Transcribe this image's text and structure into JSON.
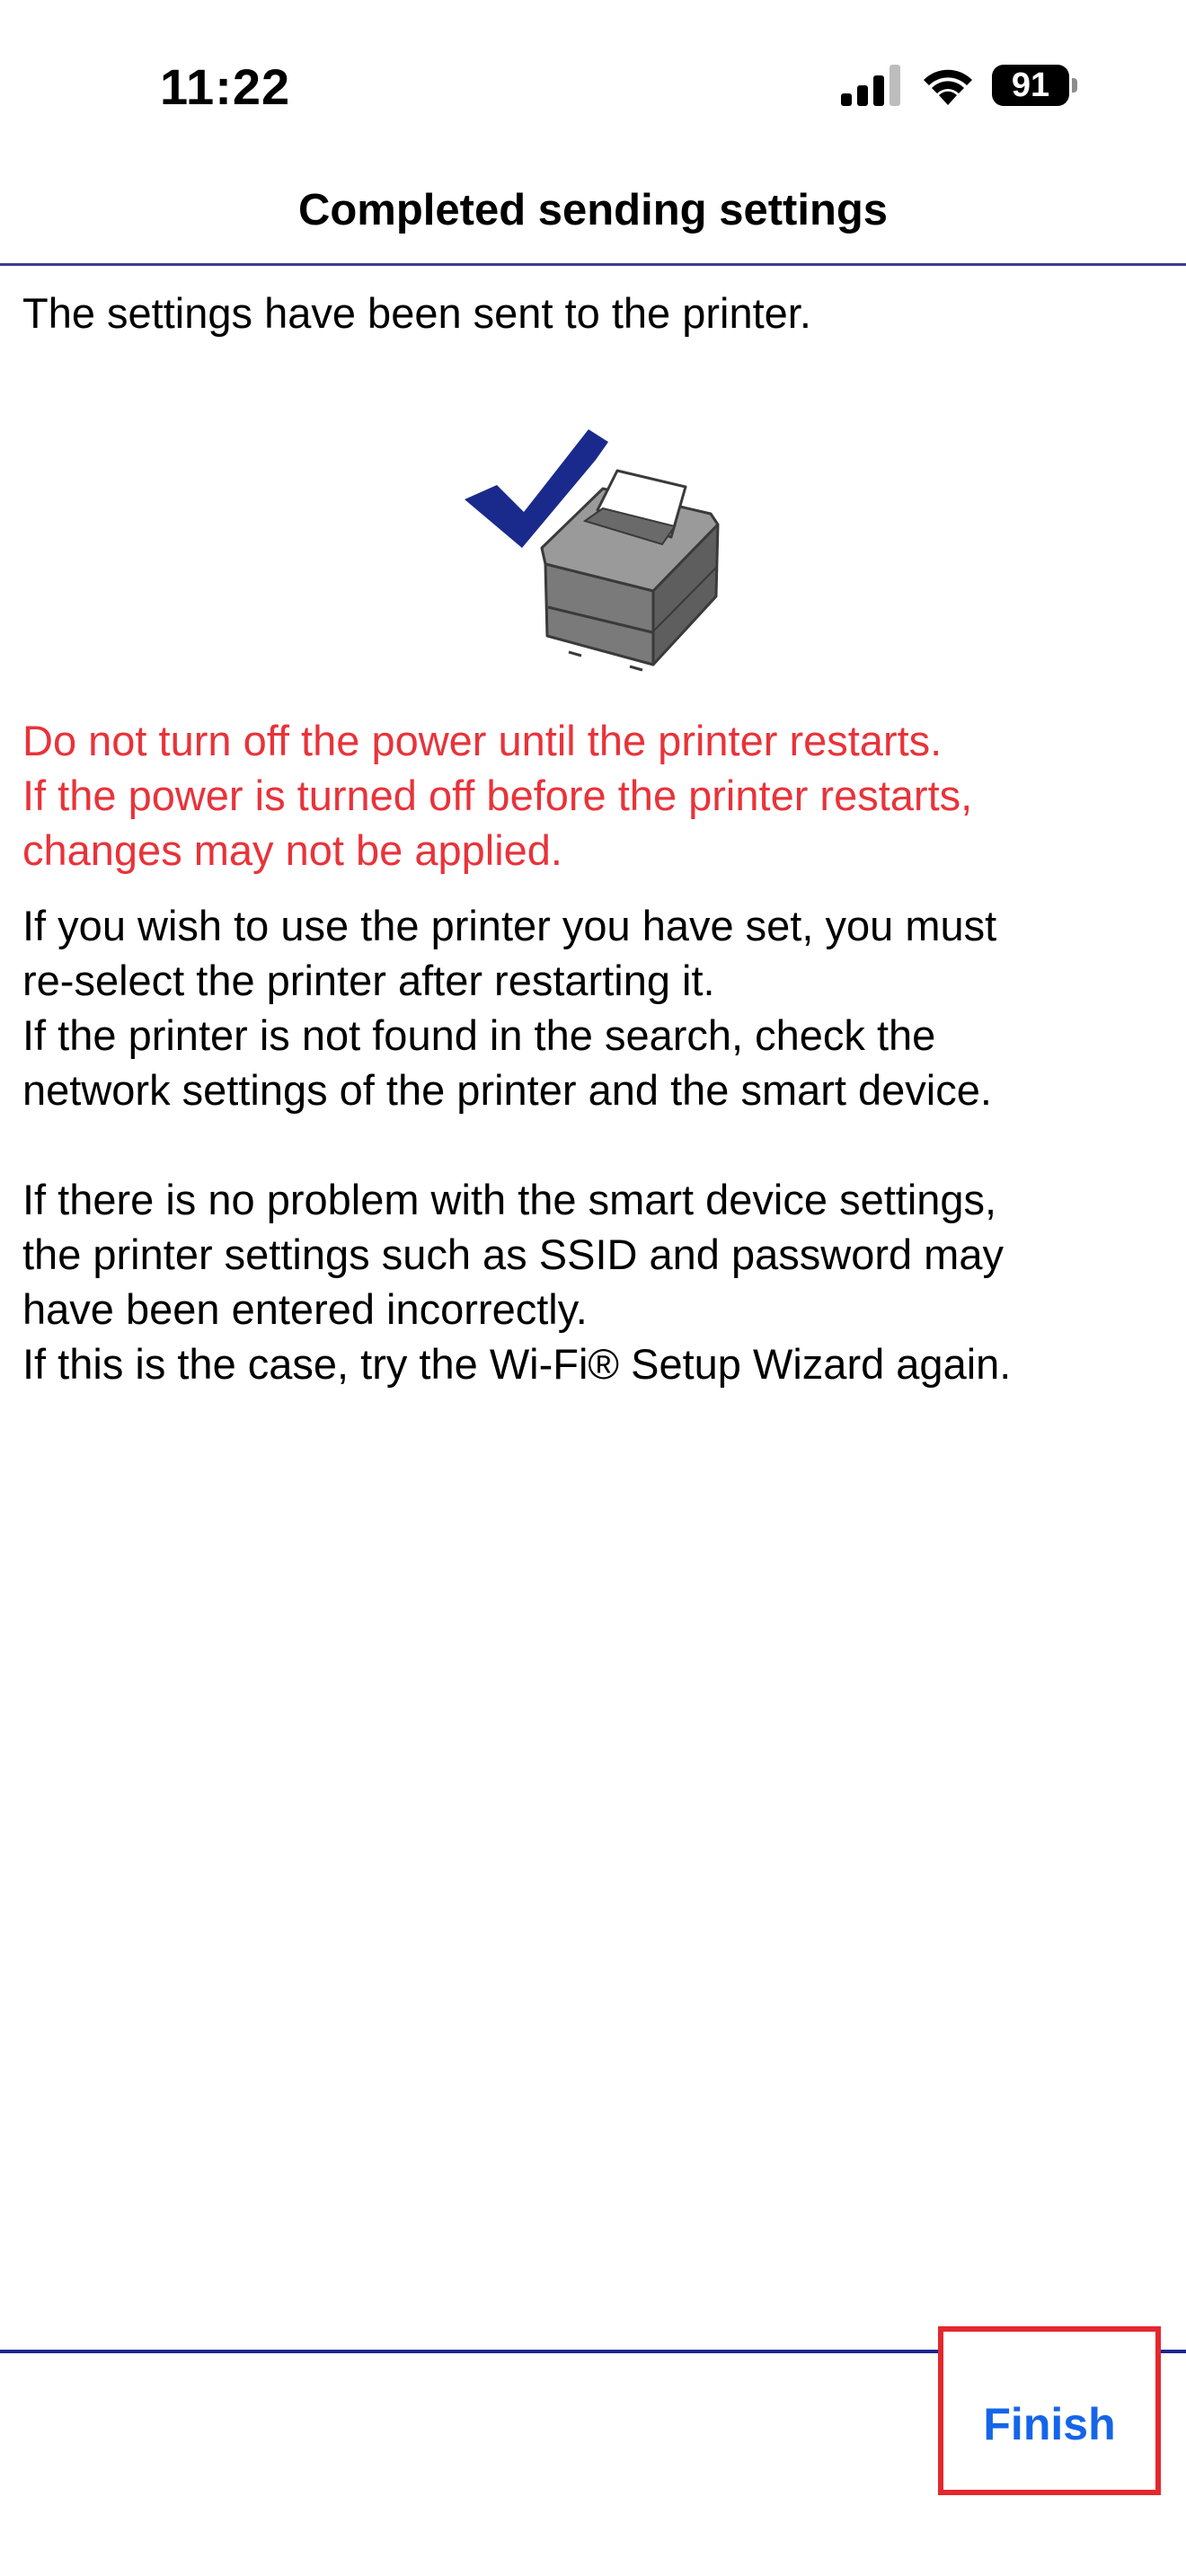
{
  "status_bar": {
    "time": "11:22",
    "battery": "91",
    "icons": [
      "signal-icon",
      "wifi-icon",
      "battery-icon"
    ]
  },
  "header": {
    "title": "Completed sending settings"
  },
  "body": {
    "intro": "The settings have been sent to the printer.",
    "illustration": [
      "checkmark-icon",
      "printer-icon"
    ],
    "warning_lines": [
      "Do not turn off the power until the printer restarts.",
      "If the power is turned off before the printer restarts,",
      "changes may not be applied."
    ],
    "info_lines": [
      "If you wish to use the printer you have set, you must",
      "re-select the printer after restarting it.",
      "If the printer is not found in the search, check the",
      "network settings of the printer and the smart device."
    ],
    "info2_lines": [
      "If there is no problem with the smart device settings,",
      "the printer settings such as SSID and password may",
      "have been entered incorrectly.",
      "If this is the case, try the Wi-Fi® Setup Wizard again."
    ]
  },
  "footer": {
    "finish_label": "Finish"
  },
  "colors": {
    "warning": "#e8333a",
    "accent": "#1565e8",
    "divider": "#1c2690",
    "highlight_box": "#e3282e",
    "checkmark": "#1a2a8c"
  }
}
